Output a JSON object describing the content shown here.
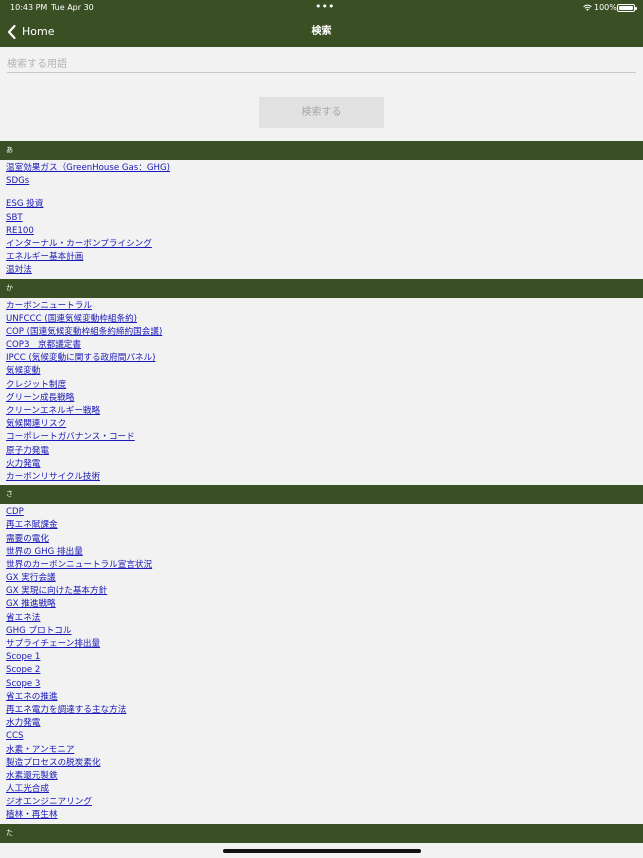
{
  "status_bar": {
    "time": "10:43 PM",
    "date": "Tue Apr 30",
    "dots": "•••",
    "battery": "100%"
  },
  "nav": {
    "back_label": "Home",
    "title": "検索"
  },
  "search": {
    "placeholder": "検索する用語",
    "value": "",
    "button_label": "検索する"
  },
  "colors": {
    "header_green": "#3b4f24",
    "link_blue": "#1a1ab8"
  },
  "sections": [
    {
      "header": "あ",
      "groups": [
        [
          "温室効果ガス（GreenHouse Gas：GHG)",
          "SDGs"
        ],
        [
          "ESG 投資",
          "SBT",
          "RE100",
          "インターナル・カーボンプライシング",
          "エネルギー基本計画",
          "温対法"
        ]
      ]
    },
    {
      "header": "か",
      "groups": [
        [
          "カーボンニュートラル",
          "UNFCCC (国連気候変動枠組条約)",
          "COP (国連気候変動枠組条約締約国会議)",
          "COP3　京都議定書",
          "IPCC (気候変動に関する政府間パネル)",
          "気候変動",
          "クレジット制度",
          "グリーン成長戦略",
          "クリーンエネルギー戦略",
          "気候関連リスク",
          "コーポレートガバナンス・コード",
          "原子力発電",
          "火力発電",
          "カーボンリサイクル技術"
        ]
      ]
    },
    {
      "header": "さ",
      "groups": [
        [
          "CDP",
          "再エネ賦課金",
          "需要の電化",
          "世界の GHG 排出量",
          "世界のカーボンニュートラル宣言状況",
          "GX 実行会議",
          "GX 実現に向けた基本方針",
          "GX 推進戦略",
          "省エネ法",
          "GHG プロトコル",
          "サプライチェーン排出量",
          "Scope 1",
          "Scope 2",
          "Scope 3",
          "省エネの推進",
          "再エネ電力を調達する主な方法",
          "水力発電",
          "CCS",
          "水素・アンモニア",
          "製造プロセスの脱炭素化",
          "水素還元製鉄",
          "人工光合成",
          "ジオエンジニアリング",
          "植林・再生林"
        ]
      ]
    },
    {
      "header": "た",
      "groups": []
    }
  ]
}
